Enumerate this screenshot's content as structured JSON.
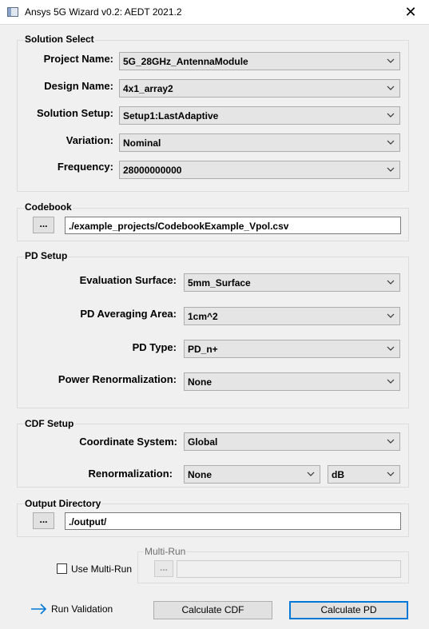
{
  "window": {
    "title": "Ansys 5G Wizard v0.2: AEDT 2021.2",
    "close_glyph": "✕"
  },
  "solution_select": {
    "title": "Solution Select",
    "project_name": {
      "label": "Project Name:",
      "value": "5G_28GHz_AntennaModule"
    },
    "design_name": {
      "label": "Design Name:",
      "value": "4x1_array2"
    },
    "solution_setup": {
      "label": "Solution Setup:",
      "value": "Setup1:LastAdaptive"
    },
    "variation": {
      "label": "Variation:",
      "value": "Nominal"
    },
    "frequency": {
      "label": "Frequency:",
      "value": "28000000000"
    }
  },
  "codebook": {
    "title": "Codebook",
    "browse_label": "...",
    "path": "./example_projects/CodebookExample_Vpol.csv"
  },
  "pd_setup": {
    "title": "PD Setup",
    "evaluation_surface": {
      "label": "Evaluation Surface:",
      "value": "5mm_Surface"
    },
    "pd_averaging_area": {
      "label": "PD Averaging Area:",
      "value": "1cm^2"
    },
    "pd_type": {
      "label": "PD Type:",
      "value": "PD_n+"
    },
    "power_renormalization": {
      "label": "Power Renormalization:",
      "value": "None"
    }
  },
  "cdf_setup": {
    "title": "CDF Setup",
    "coordinate_system": {
      "label": "Coordinate System:",
      "value": "Global"
    },
    "renormalization": {
      "label": "Renormalization:",
      "value": "None",
      "unit_value": "dB"
    }
  },
  "output_directory": {
    "title": "Output Directory",
    "browse_label": "...",
    "path": "./output/"
  },
  "multi_run": {
    "checkbox_label": "Use Multi-Run",
    "checked": false,
    "group_title": "Multi-Run",
    "browse_label": "...",
    "path": ""
  },
  "footer": {
    "run_validation_label": "Run Validation",
    "calculate_cdf_label": "Calculate CDF",
    "calculate_pd_label": "Calculate PD"
  },
  "colors": {
    "accent": "#0078d7",
    "background": "#f0f0f0"
  },
  "icons": {
    "app": "window-icon",
    "close": "close-icon",
    "dropdown": "chevron-down-icon",
    "arrow": "arrow-right-icon"
  }
}
